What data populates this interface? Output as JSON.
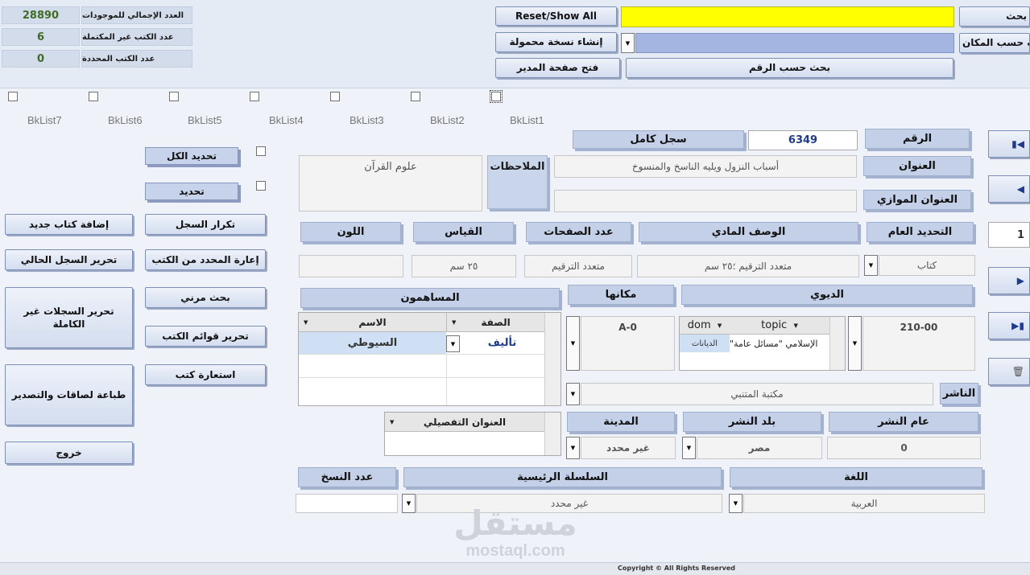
{
  "summary": {
    "total_label": "العدد الإجمالي للموجودات",
    "total_value": "28890",
    "incomplete_label": "عدد الكتب غير المكتملة",
    "incomplete_value": "6",
    "selected_label": "عدد الكتب المحددة",
    "selected_value": "0"
  },
  "top": {
    "reset_show_all": "Reset/Show All",
    "create_portable": "إنشاء نسخة محمولة",
    "open_manager": "فتح صفحة المدير",
    "search_by_number": "بحث حسب الرقم",
    "search_label": "بحث",
    "search_place_label": "بحث حسب المكان"
  },
  "bklists": [
    "BkList7",
    "BkList6",
    "BkList5",
    "BkList4",
    "BkList3",
    "BkList2",
    "BkList1"
  ],
  "left": {
    "select_all": "تحديد الكل",
    "select": "تحديد",
    "add_new_book": "إضافة كتاب جديد",
    "repeat_record": "تكرار السجل",
    "edit_current": "تحرير السجل الحالي",
    "return_selected": "إعارة المحدد من الكتب",
    "edit_incomplete": "تحرير السجلات غير الكاملة",
    "flexible_search": "بحث مرني",
    "edit_book_lists": "تحرير قوائم الكتب",
    "print_labels": "طباعة لصاقات والتصدير",
    "borrow_books": "استعارة كتب",
    "exit": "خروج"
  },
  "record": {
    "number_label": "الرقم",
    "number_value": "6349",
    "full_record_label": "سجل كامل",
    "title_label": "العنوان",
    "title_value": "أسباب النزول ويليه الناسخ والمنسوخ",
    "parallel_title_label": "العنوان الموازي",
    "parallel_title_value": "",
    "notes_label": "الملاحظات",
    "notes_value": "علوم القرآن"
  },
  "physical": {
    "general_label": "التحديد العام",
    "general_value": "كتاب",
    "description_label": "الوصف المادي",
    "description_value": "متعدد الترقيم ؛٢٥ سم",
    "pages_label": "عدد الصفحات",
    "pages_value": "متعدد الترقيم",
    "size_label": "القياس",
    "size_value": "٢٥ سم",
    "color_label": "اللون",
    "color_value": ""
  },
  "dewey": {
    "label": "الديوي",
    "value": "210-00",
    "topic_header": "topic",
    "dom_header": "dom",
    "topic_cell": "الإسلامي \"مسائل عامة\"",
    "dom_cell": "الديانات"
  },
  "location": {
    "label": "مكانها",
    "value": "A-0"
  },
  "contributors": {
    "label": "المساهمون",
    "name_header": "الاسم",
    "role_header": "الصفة",
    "rows": [
      {
        "name": "السيوطي",
        "role": "تأليف"
      }
    ]
  },
  "publisher": {
    "label": "الناشر",
    "value": "مكتبة المتنبي"
  },
  "pub": {
    "year_label": "عام النشر",
    "year_value": "0",
    "country_label": "بلد النشر",
    "country_value": "مصر",
    "city_label": "المدينة",
    "city_value": "غير محدد",
    "detailed_title_label": "العنوان التفصيلي"
  },
  "lang": {
    "language_label": "اللغة",
    "language_value": "العربية",
    "series_label": "السلسلة الرئيسية",
    "series_value": "غير محدد",
    "copies_label": "عدد النسخ",
    "copies_value": ""
  },
  "nav": {
    "record_index": "1"
  },
  "watermark": {
    "brand": "مستقل",
    "site": "mostaql.com"
  },
  "footer": {
    "copyright": "Copyright © All Rights Reserved"
  },
  "colors": {
    "search_yellow": "#ffff00",
    "blue_bar": "#a3b5e0",
    "label_bg": "#c9d5ea",
    "value_green": "#3f6b26"
  }
}
